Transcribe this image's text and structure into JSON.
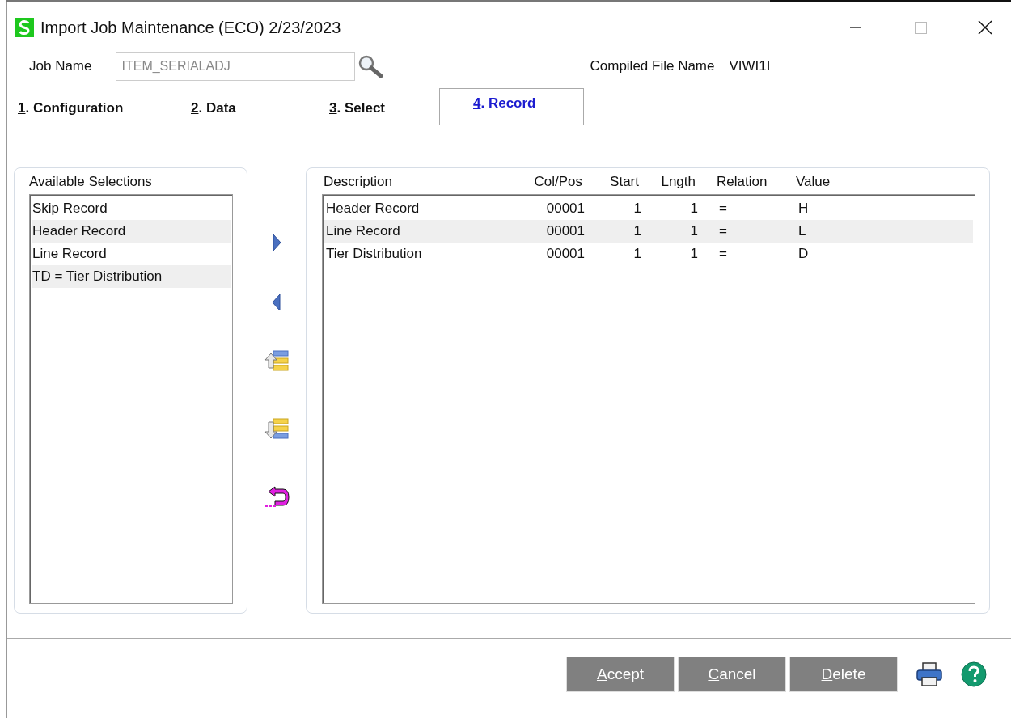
{
  "window": {
    "title": "Import Job Maintenance (ECO) 2/23/2023"
  },
  "job_name": {
    "label": "Job Name",
    "value": "ITEM_SERIALADJ"
  },
  "compiled_file": {
    "label": "Compiled File Name",
    "value": "VIWI1I"
  },
  "tabs": [
    {
      "hotkey": "1",
      "rest": ". Configuration",
      "selected": false
    },
    {
      "hotkey": "2",
      "rest": ". Data",
      "selected": false
    },
    {
      "hotkey": "3",
      "rest": ". Select",
      "selected": false
    },
    {
      "hotkey": "4",
      "rest": ". Record",
      "selected": true
    }
  ],
  "available_selections": {
    "title": "Available Selections",
    "items": [
      "Skip Record",
      "Header Record",
      "Line Record",
      "TD = Tier Distribution"
    ]
  },
  "records": {
    "columns": [
      "Description",
      "Col/Pos",
      "Start",
      "Lngth",
      "Relation",
      "Value"
    ],
    "rows": [
      [
        "Header Record",
        "00001",
        "1",
        "1",
        "=",
        "H"
      ],
      [
        "Line Record",
        "00001",
        "1",
        "1",
        "=",
        "L"
      ],
      [
        "Tier Distribution",
        "00001",
        "1",
        "1",
        "=",
        "D"
      ]
    ]
  },
  "buttons": [
    {
      "hotkey": "A",
      "rest": "ccept"
    },
    {
      "hotkey": "C",
      "rest": "ancel"
    },
    {
      "hotkey": "D",
      "rest": "elete"
    }
  ]
}
